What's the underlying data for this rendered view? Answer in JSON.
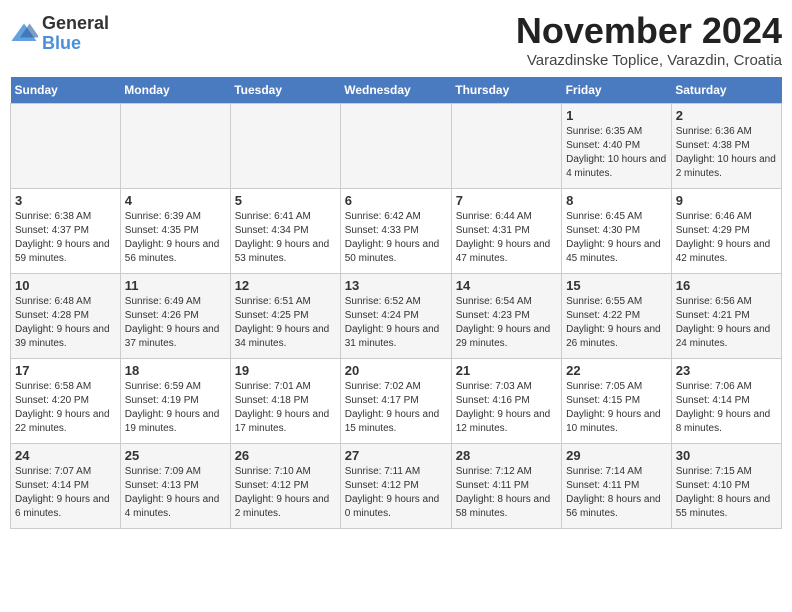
{
  "logo": {
    "general": "General",
    "blue": "Blue"
  },
  "header": {
    "month": "November 2024",
    "location": "Varazdinske Toplice, Varazdin, Croatia"
  },
  "weekdays": [
    "Sunday",
    "Monday",
    "Tuesday",
    "Wednesday",
    "Thursday",
    "Friday",
    "Saturday"
  ],
  "weeks": [
    [
      {
        "day": "",
        "details": ""
      },
      {
        "day": "",
        "details": ""
      },
      {
        "day": "",
        "details": ""
      },
      {
        "day": "",
        "details": ""
      },
      {
        "day": "",
        "details": ""
      },
      {
        "day": "1",
        "details": "Sunrise: 6:35 AM\nSunset: 4:40 PM\nDaylight: 10 hours and 4 minutes."
      },
      {
        "day": "2",
        "details": "Sunrise: 6:36 AM\nSunset: 4:38 PM\nDaylight: 10 hours and 2 minutes."
      }
    ],
    [
      {
        "day": "3",
        "details": "Sunrise: 6:38 AM\nSunset: 4:37 PM\nDaylight: 9 hours and 59 minutes."
      },
      {
        "day": "4",
        "details": "Sunrise: 6:39 AM\nSunset: 4:35 PM\nDaylight: 9 hours and 56 minutes."
      },
      {
        "day": "5",
        "details": "Sunrise: 6:41 AM\nSunset: 4:34 PM\nDaylight: 9 hours and 53 minutes."
      },
      {
        "day": "6",
        "details": "Sunrise: 6:42 AM\nSunset: 4:33 PM\nDaylight: 9 hours and 50 minutes."
      },
      {
        "day": "7",
        "details": "Sunrise: 6:44 AM\nSunset: 4:31 PM\nDaylight: 9 hours and 47 minutes."
      },
      {
        "day": "8",
        "details": "Sunrise: 6:45 AM\nSunset: 4:30 PM\nDaylight: 9 hours and 45 minutes."
      },
      {
        "day": "9",
        "details": "Sunrise: 6:46 AM\nSunset: 4:29 PM\nDaylight: 9 hours and 42 minutes."
      }
    ],
    [
      {
        "day": "10",
        "details": "Sunrise: 6:48 AM\nSunset: 4:28 PM\nDaylight: 9 hours and 39 minutes."
      },
      {
        "day": "11",
        "details": "Sunrise: 6:49 AM\nSunset: 4:26 PM\nDaylight: 9 hours and 37 minutes."
      },
      {
        "day": "12",
        "details": "Sunrise: 6:51 AM\nSunset: 4:25 PM\nDaylight: 9 hours and 34 minutes."
      },
      {
        "day": "13",
        "details": "Sunrise: 6:52 AM\nSunset: 4:24 PM\nDaylight: 9 hours and 31 minutes."
      },
      {
        "day": "14",
        "details": "Sunrise: 6:54 AM\nSunset: 4:23 PM\nDaylight: 9 hours and 29 minutes."
      },
      {
        "day": "15",
        "details": "Sunrise: 6:55 AM\nSunset: 4:22 PM\nDaylight: 9 hours and 26 minutes."
      },
      {
        "day": "16",
        "details": "Sunrise: 6:56 AM\nSunset: 4:21 PM\nDaylight: 9 hours and 24 minutes."
      }
    ],
    [
      {
        "day": "17",
        "details": "Sunrise: 6:58 AM\nSunset: 4:20 PM\nDaylight: 9 hours and 22 minutes."
      },
      {
        "day": "18",
        "details": "Sunrise: 6:59 AM\nSunset: 4:19 PM\nDaylight: 9 hours and 19 minutes."
      },
      {
        "day": "19",
        "details": "Sunrise: 7:01 AM\nSunset: 4:18 PM\nDaylight: 9 hours and 17 minutes."
      },
      {
        "day": "20",
        "details": "Sunrise: 7:02 AM\nSunset: 4:17 PM\nDaylight: 9 hours and 15 minutes."
      },
      {
        "day": "21",
        "details": "Sunrise: 7:03 AM\nSunset: 4:16 PM\nDaylight: 9 hours and 12 minutes."
      },
      {
        "day": "22",
        "details": "Sunrise: 7:05 AM\nSunset: 4:15 PM\nDaylight: 9 hours and 10 minutes."
      },
      {
        "day": "23",
        "details": "Sunrise: 7:06 AM\nSunset: 4:14 PM\nDaylight: 9 hours and 8 minutes."
      }
    ],
    [
      {
        "day": "24",
        "details": "Sunrise: 7:07 AM\nSunset: 4:14 PM\nDaylight: 9 hours and 6 minutes."
      },
      {
        "day": "25",
        "details": "Sunrise: 7:09 AM\nSunset: 4:13 PM\nDaylight: 9 hours and 4 minutes."
      },
      {
        "day": "26",
        "details": "Sunrise: 7:10 AM\nSunset: 4:12 PM\nDaylight: 9 hours and 2 minutes."
      },
      {
        "day": "27",
        "details": "Sunrise: 7:11 AM\nSunset: 4:12 PM\nDaylight: 9 hours and 0 minutes."
      },
      {
        "day": "28",
        "details": "Sunrise: 7:12 AM\nSunset: 4:11 PM\nDaylight: 8 hours and 58 minutes."
      },
      {
        "day": "29",
        "details": "Sunrise: 7:14 AM\nSunset: 4:11 PM\nDaylight: 8 hours and 56 minutes."
      },
      {
        "day": "30",
        "details": "Sunrise: 7:15 AM\nSunset: 4:10 PM\nDaylight: 8 hours and 55 minutes."
      }
    ]
  ]
}
